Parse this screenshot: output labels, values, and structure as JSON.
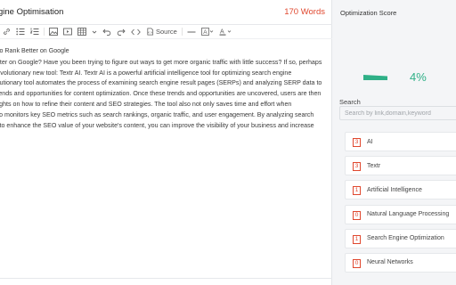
{
  "editor": {
    "title": "gine Optimisation",
    "word_count": "170 Words",
    "toolbar": {
      "source_label": "Source",
      "icons": [
        "link-icon",
        "unordered-list-icon",
        "ordered-list-icon",
        "image-icon",
        "video-icon",
        "table-icon",
        "chevron-down-icon",
        "undo-icon",
        "redo-icon",
        "code-icon",
        "source-icon",
        "horizontal-rule-icon",
        "background-color-icon",
        "font-color-icon"
      ]
    },
    "content": {
      "heading": "l to Rank Better on Google",
      "lines": [
        "etter on Google? Have you been trying to figure out ways to get more organic traffic with little success? If so, perhaps",
        "revolutionary new tool: Textr AI. Textr AI is a powerful artificial intelligence tool for optimizing search engine",
        "olutionary tool automates the process of examining search engine result pages (SERPs) and analyzing SERP data to",
        "trends and opportunities for content optimization. Once these trends and opportunities are uncovered, users are then",
        "sights on how to refine their content and SEO strategies. The tool also not only saves time and effort when",
        "lso monitors key SEO metrics such as search rankings, organic traffic, and user engagement. By analyzing search",
        "s to enhance the SEO value of your website's content, you can improve the visibility of your business and increase"
      ]
    }
  },
  "sidebar": {
    "score_title": "Optimization Score",
    "score_value": "4%",
    "score_fraction": 0.04,
    "score_color": "#2fb087",
    "search_label": "Search",
    "search_placeholder": "Search by link,domain,keyword",
    "keywords": [
      {
        "count": "3",
        "label": "AI"
      },
      {
        "count": "3",
        "label": "Textr"
      },
      {
        "count": "1",
        "label": "Artificial Intelligence"
      },
      {
        "count": "0",
        "label": "Natural Language Processing"
      },
      {
        "count": "1",
        "label": "Search Engine Optimization"
      },
      {
        "count": "0",
        "label": "Neural Networks"
      }
    ]
  },
  "colors": {
    "accent_red": "#e0482f",
    "accent_green": "#2fb087"
  }
}
